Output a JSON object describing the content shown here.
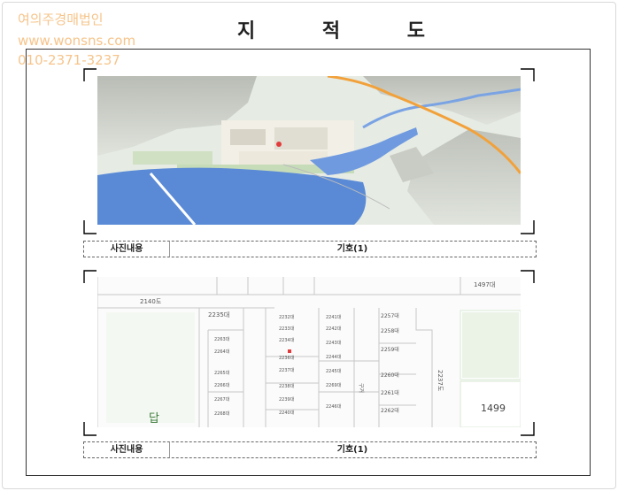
{
  "watermark": {
    "company": "여의주경매법인",
    "website": "www.wonsns.com",
    "phone": "010-2371-3237"
  },
  "title": "지 적 도",
  "sections": [
    {
      "caption_left": "사진내용",
      "caption_right": "기호(1)"
    },
    {
      "caption_left": "사진내용",
      "caption_right": "기호(1)"
    }
  ],
  "cadastral": {
    "lot_labels": [
      "2140도",
      "2235대",
      "1497대",
      "2232대",
      "2233대",
      "2234대",
      "2236대",
      "2237대",
      "2238대",
      "2239대",
      "2240대",
      "2241대",
      "2242대",
      "2243대",
      "2244대",
      "2245대",
      "2246대",
      "2257대",
      "2258대",
      "2259대",
      "2260대",
      "2261대",
      "2262대",
      "2263대",
      "2264대",
      "2265대",
      "2266대",
      "2267대",
      "2268대",
      "2269대",
      "1499",
      "구거"
    ],
    "road_label": "2237도",
    "bottom_left_label": "답"
  }
}
